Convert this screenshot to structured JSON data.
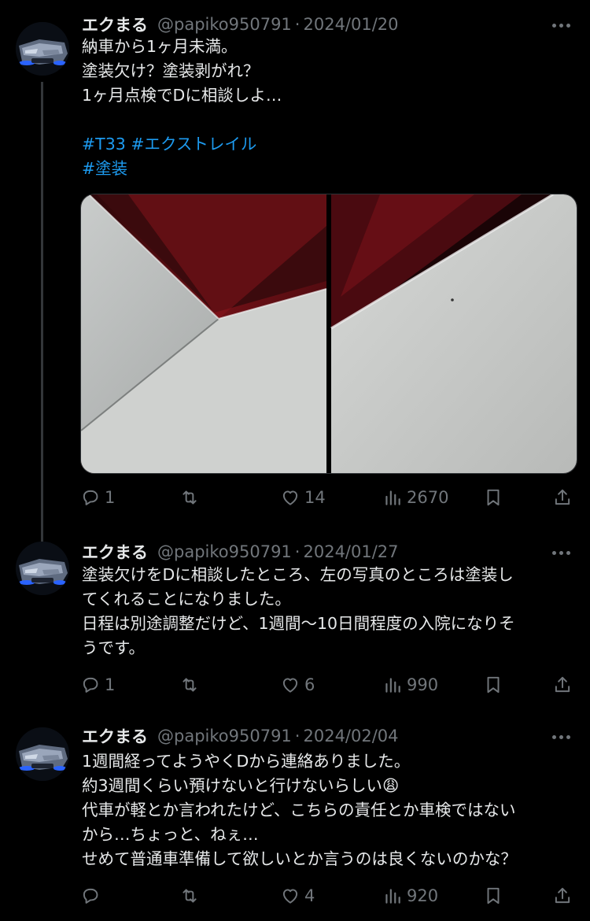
{
  "tweets": [
    {
      "name": "エクまる",
      "handle": "@papiko950791",
      "separator": "·",
      "date": "2024/01/20",
      "lines": [
        "納車から1ヶ月未満。",
        "塗装欠け？塗装剥がれ？",
        "1ヶ月点検でDに相談しよ…"
      ],
      "hashtags": [
        "#T33",
        "#エクストレイル",
        "#塗装"
      ],
      "replies": "1",
      "retweets": "",
      "likes": "14",
      "views": "2670"
    },
    {
      "name": "エクまる",
      "handle": "@papiko950791",
      "separator": "·",
      "date": "2024/01/27",
      "lines": [
        "塗装欠けをDに相談したところ、左の写真のところは塗装し",
        "てくれることになりました。",
        "日程は別途調整だけど、1週間〜10日間程度の入院になりそ",
        "うです。"
      ],
      "replies": "1",
      "retweets": "",
      "likes": "6",
      "views": "990"
    },
    {
      "name": "エクまる",
      "handle": "@papiko950791",
      "separator": "·",
      "date": "2024/02/04",
      "lines": [
        "1週間経ってようやくDから連絡ありました。",
        "約3週間くらい預けないと行けないらしい😩",
        "代車が軽とか言われたけど、こちらの責任とか車検ではない",
        "から…ちょっと、ねぇ…",
        "せめて普通車準備して欲しいとか言うのは良くないのかな？"
      ],
      "replies": "",
      "retweets": "",
      "likes": "4",
      "views": "920"
    }
  ],
  "icons": {
    "reply": "reply-icon",
    "retweet": "retweet-icon",
    "like": "heart-icon",
    "views": "views-icon",
    "bookmark": "bookmark-icon",
    "share": "share-icon",
    "more": "more-icon"
  },
  "colors": {
    "background": "#000000",
    "text": "#e7e9ea",
    "muted": "#71767b",
    "link": "#1d9bf0"
  }
}
